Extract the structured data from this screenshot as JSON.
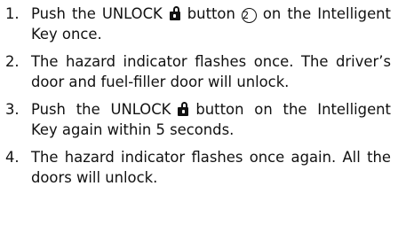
{
  "steps": [
    {
      "number": "1.",
      "before_icon": "Push the UNLOCK",
      "icon": "unlock-padlock-icon",
      "after_icon": "button",
      "callout": "2",
      "after_callout": "on the Intelligent Key once."
    },
    {
      "number": "2.",
      "text": "The hazard indicator flashes once. The driver’s door and fuel-filler door will unlock."
    },
    {
      "number": "3.",
      "before_icon": "Push the UNLOCK",
      "icon": "unlock-padlock-icon",
      "after_icon": "button on the Intelligent Key again within 5 seconds."
    },
    {
      "number": "4.",
      "text": "The hazard indicator flashes once again. All the doors will unlock."
    }
  ]
}
